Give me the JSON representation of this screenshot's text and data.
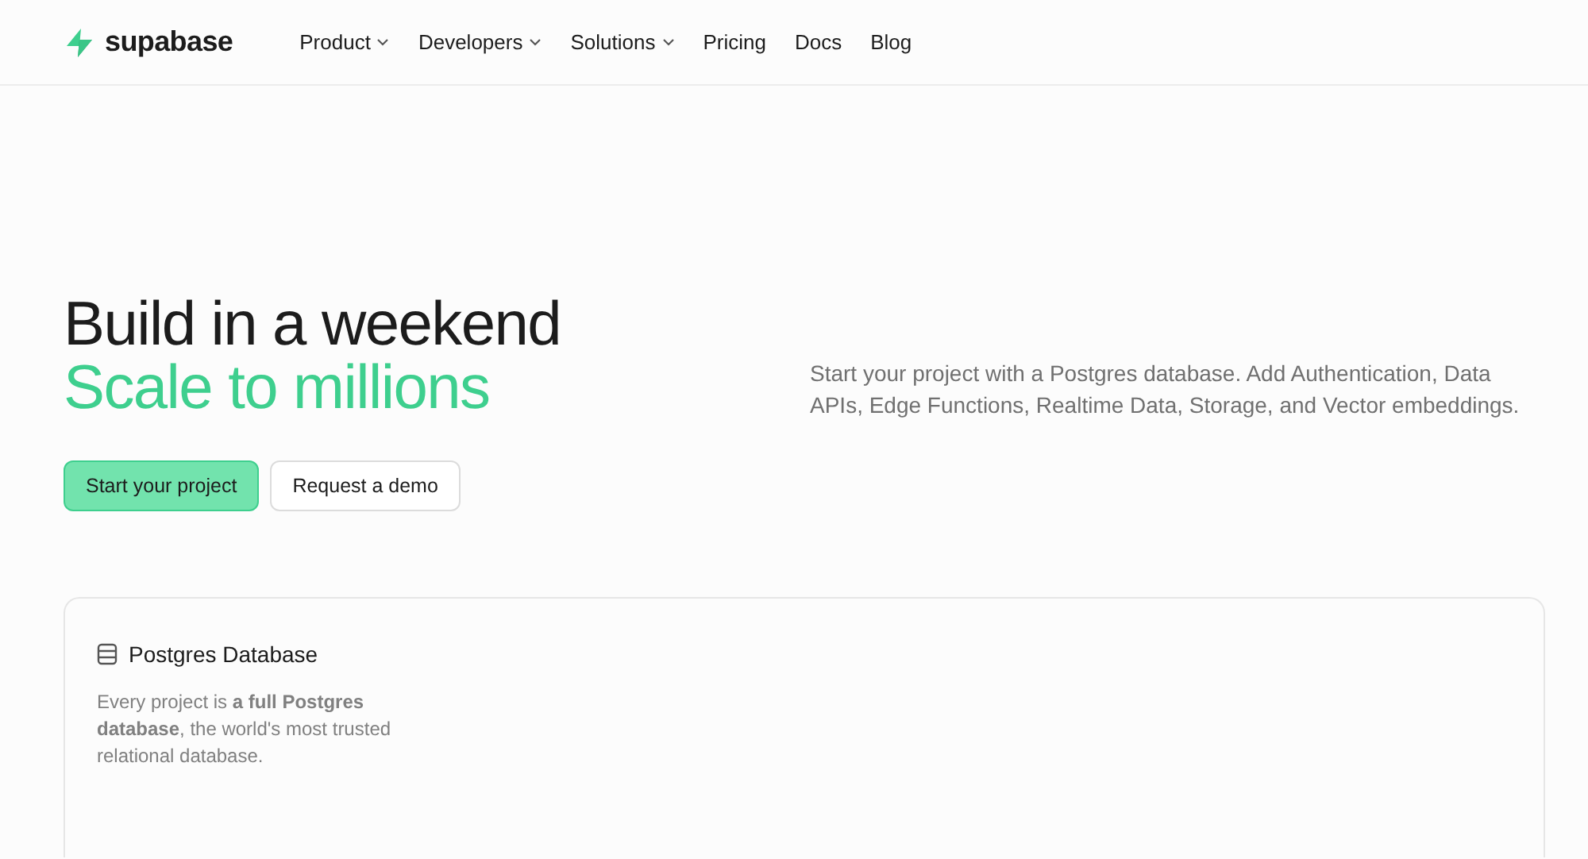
{
  "brand": {
    "name": "supabase"
  },
  "nav": [
    {
      "label": "Product",
      "has_menu": true
    },
    {
      "label": "Developers",
      "has_menu": true
    },
    {
      "label": "Solutions",
      "has_menu": true
    },
    {
      "label": "Pricing",
      "has_menu": false
    },
    {
      "label": "Docs",
      "has_menu": false
    },
    {
      "label": "Blog",
      "has_menu": false
    }
  ],
  "hero": {
    "title_line_1": "Build in a weekend",
    "title_line_2": "Scale to millions",
    "description": "Start your project with a Postgres database. Add Authentication, Data APIs, Edge Functions, Realtime Data, Storage, and Vector embeddings.",
    "buttons": [
      {
        "label": "Start your project",
        "kind": "primary"
      },
      {
        "label": "Request a demo",
        "kind": "secondary"
      }
    ]
  },
  "feature_card": {
    "title": "Postgres Database",
    "text": "Every project is **a full Postgres database**, the world's most trusted relational database."
  }
}
